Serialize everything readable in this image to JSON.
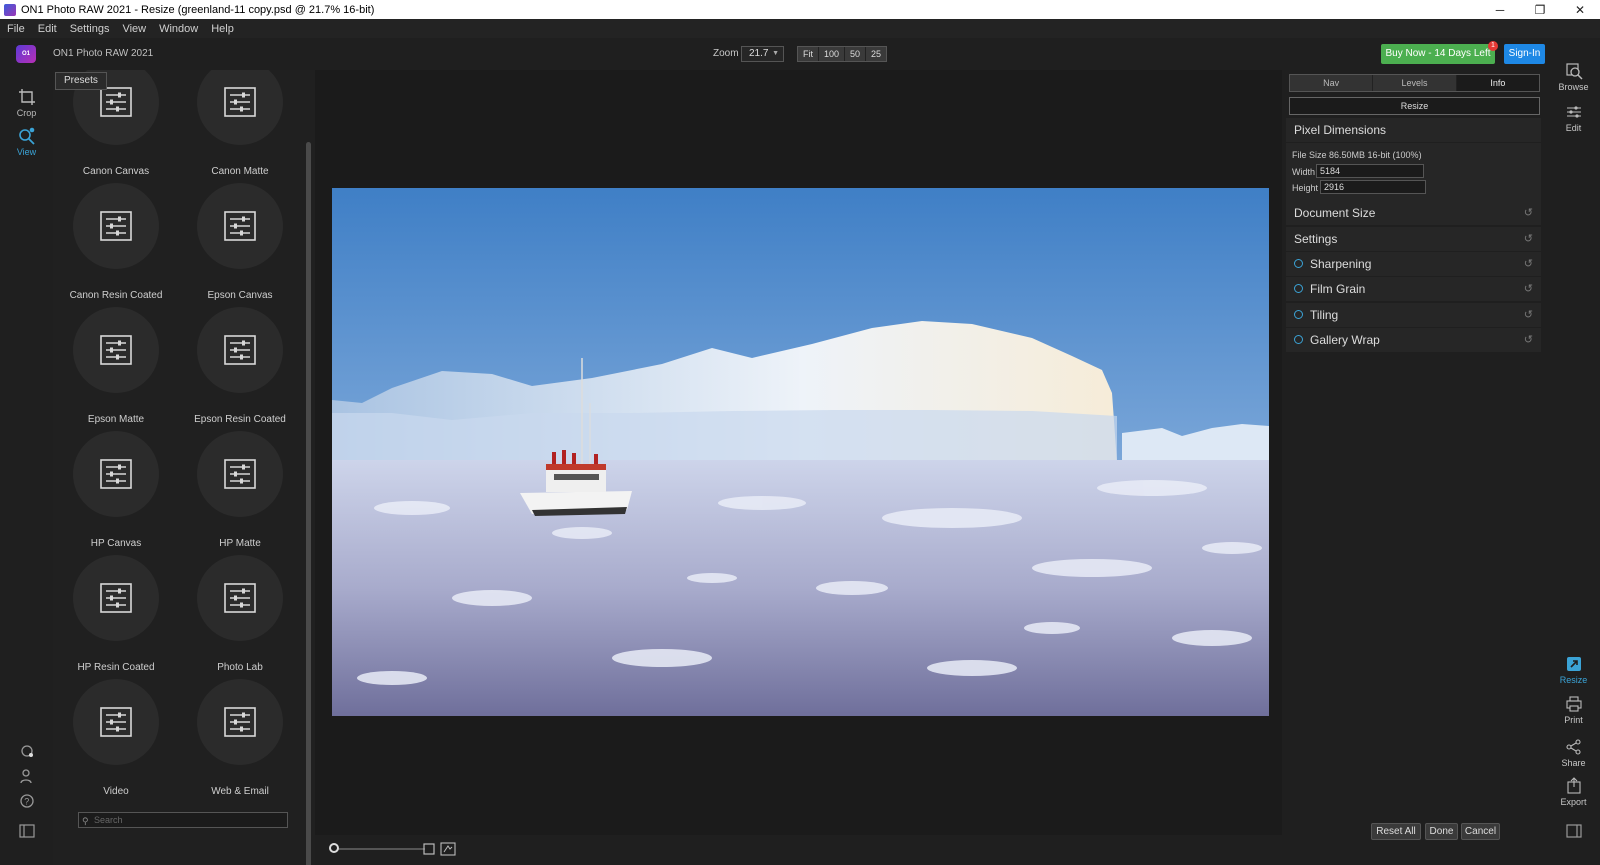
{
  "window": {
    "title": "ON1 Photo RAW 2021 - Resize (greenland-11 copy.psd @ 21.7% 16-bit)"
  },
  "menu": [
    "File",
    "Edit",
    "Settings",
    "View",
    "Window",
    "Help"
  ],
  "topbar": {
    "logo_text": "O1",
    "app_label": "ON1 Photo RAW 2021",
    "zoom_label": "Zoom",
    "zoom_value": "21.7",
    "zoom_buttons": [
      "Fit",
      "100",
      "50",
      "25"
    ],
    "buy_label": "Buy Now - 14 Days Left",
    "badge": "1",
    "signin_label": "Sign-In"
  },
  "left_rail": {
    "crop": "Crop",
    "view": "View"
  },
  "presets": {
    "tab_label": "Presets",
    "items": [
      "Canon Canvas",
      "Canon Matte",
      "Canon Resin Coated",
      "Epson Canvas",
      "Epson Matte",
      "Epson Resin Coated",
      "HP Canvas",
      "HP Matte",
      "HP Resin Coated",
      "Photo Lab",
      "Video",
      "Web & Email"
    ],
    "search_placeholder": "Search"
  },
  "right_panel": {
    "tabs": [
      "Nav",
      "Levels",
      "Info"
    ],
    "resize_tab": "Resize",
    "pixel_dimensions": {
      "title": "Pixel Dimensions",
      "file_size": "File Size 86.50MB 16-bit (100%)",
      "width_label": "Width",
      "width_value": "5184",
      "height_label": "Height",
      "height_value": "2916"
    },
    "sections": [
      "Document Size",
      "Settings"
    ],
    "toggles": [
      "Sharpening",
      "Film Grain",
      "Tiling",
      "Gallery Wrap"
    ],
    "buttons": {
      "reset_all": "Reset All",
      "done": "Done",
      "cancel": "Cancel"
    }
  },
  "right_rail": {
    "browse": "Browse",
    "edit": "Edit",
    "resize": "Resize",
    "print": "Print",
    "share": "Share",
    "export": "Export"
  },
  "colors": {
    "accent": "#3ba3d6",
    "buy": "#4caf50",
    "signin": "#1e88e5"
  }
}
